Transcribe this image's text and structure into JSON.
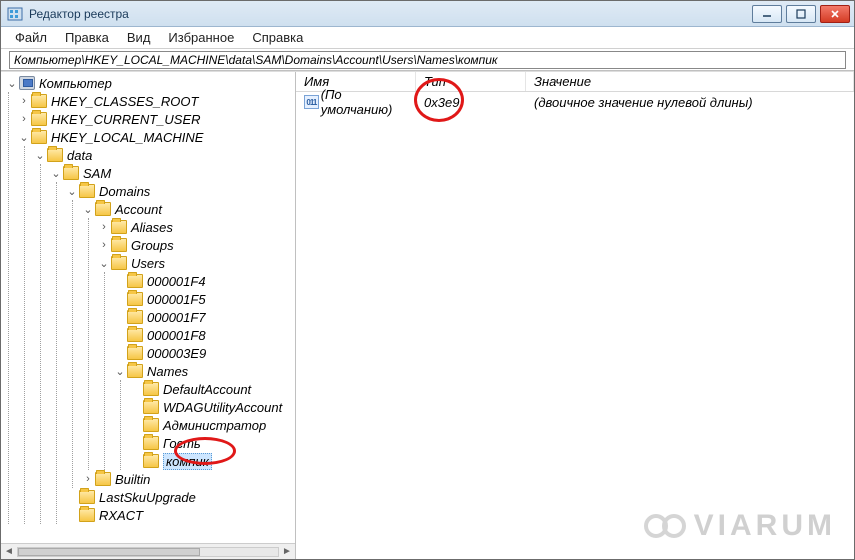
{
  "window": {
    "title": "Редактор реестра"
  },
  "menu": {
    "file": "Файл",
    "edit": "Правка",
    "view": "Вид",
    "favorites": "Избранное",
    "help": "Справка"
  },
  "address": {
    "value": "Компьютер\\HKEY_LOCAL_MACHINE\\data\\SAM\\Domains\\Account\\Users\\Names\\компик"
  },
  "tree": {
    "root": "Компьютер",
    "hkcr": "HKEY_CLASSES_ROOT",
    "hkcu": "HKEY_CURRENT_USER",
    "hklm": "HKEY_LOCAL_MACHINE",
    "data": "data",
    "sam": "SAM",
    "domains": "Domains",
    "account": "Account",
    "aliases": "Aliases",
    "groups": "Groups",
    "users": "Users",
    "u1": "000001F4",
    "u2": "000001F5",
    "u3": "000001F7",
    "u4": "000001F8",
    "u5": "000003E9",
    "names": "Names",
    "n1": "DefaultAccount",
    "n2": "WDAGUtilityAccount",
    "n3": "Администратор",
    "n4": "Гость",
    "n5": "компик",
    "builtin": "Builtin",
    "lastsku": "LastSkuUpgrade",
    "rxact": "RXACT"
  },
  "list": {
    "cols": {
      "name": "Имя",
      "type": "Тип",
      "value": "Значение"
    },
    "row0": {
      "name": "(По умолчанию)",
      "type": "0x3e9",
      "value": "(двоичное значение нулевой длины)"
    }
  },
  "watermark": {
    "text": "VIARUM"
  }
}
